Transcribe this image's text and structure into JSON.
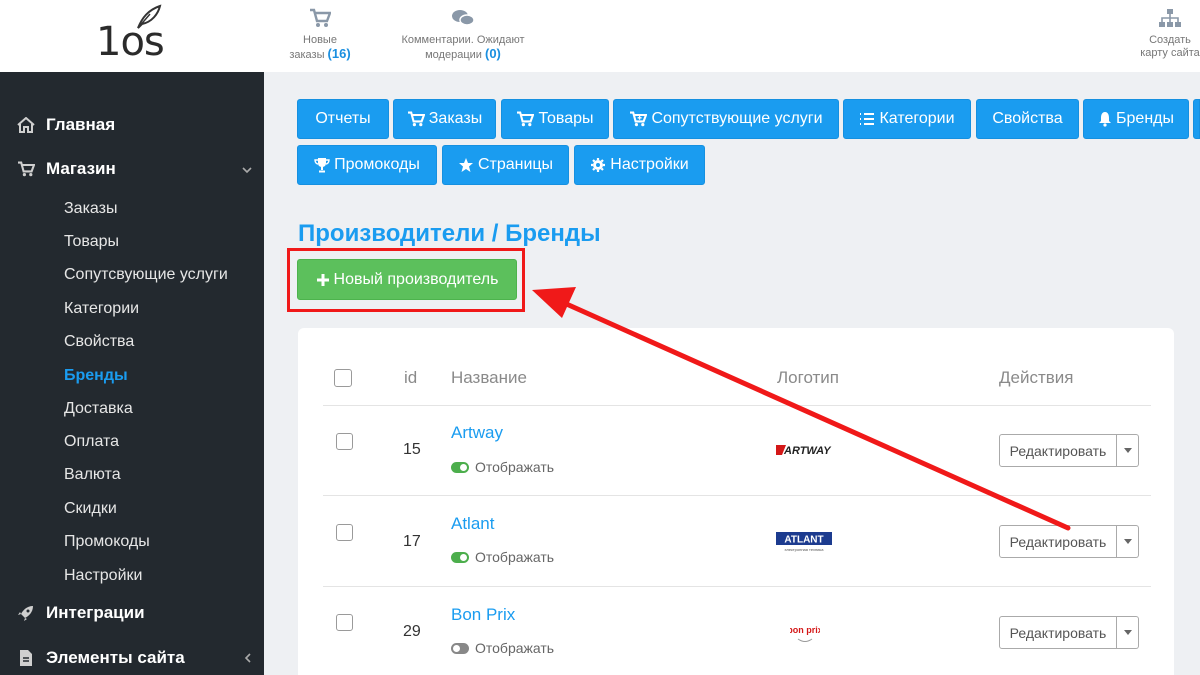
{
  "header": {
    "logo_text": "1os",
    "orders": {
      "line1": "Новые",
      "line2": "заказы",
      "count": "(16)"
    },
    "comments": {
      "line1": "Комментарии. Ожидают",
      "line2": "модерации",
      "count": "(0)"
    },
    "sitemap": {
      "line1": "Создать",
      "line2": "карту сайта"
    }
  },
  "sidebar": {
    "home": "Главная",
    "shop": "Магазин",
    "shop_items": [
      "Заказы",
      "Товары",
      "Сопутсвующие услуги",
      "Категории",
      "Свойства",
      "Бренды",
      "Доставка",
      "Оплата",
      "Валюта",
      "Скидки",
      "Промокоды",
      "Настройки"
    ],
    "integrations": "Интеграции",
    "site_elements": "Элементы сайта"
  },
  "toolbar": {
    "reports": "Отчеты",
    "orders": "Заказы",
    "products": "Товары",
    "services": "Сопутствующие услуги",
    "categories": "Категории",
    "properties": "Свойства",
    "brands": "Бренды",
    "promocodes": "Промокоды",
    "pages": "Страницы",
    "settings": "Настройки"
  },
  "page": {
    "title": "Производители / Бренды",
    "new_button": "Новый производитель"
  },
  "table": {
    "headers": {
      "id": "id",
      "name": "Название",
      "logo": "Логотип",
      "actions": "Действия"
    },
    "rows": [
      {
        "id": "15",
        "name": "Artway",
        "status": "Отображать",
        "enabled": true,
        "logo": "ARTWAY",
        "edit": "Редактировать"
      },
      {
        "id": "17",
        "name": "Atlant",
        "status": "Отображать",
        "enabled": true,
        "logo": "ATLANT",
        "logo_sub": "электронная техника",
        "edit": "Редактировать"
      },
      {
        "id": "29",
        "name": "Bon Prix",
        "status": "Отображать",
        "enabled": false,
        "logo": "bon prix",
        "edit": "Редактировать"
      }
    ]
  },
  "colors": {
    "accent": "#1a9cf0",
    "success": "#5cc05c",
    "annotation": "#f01919",
    "sidebar_bg": "#23292f"
  }
}
